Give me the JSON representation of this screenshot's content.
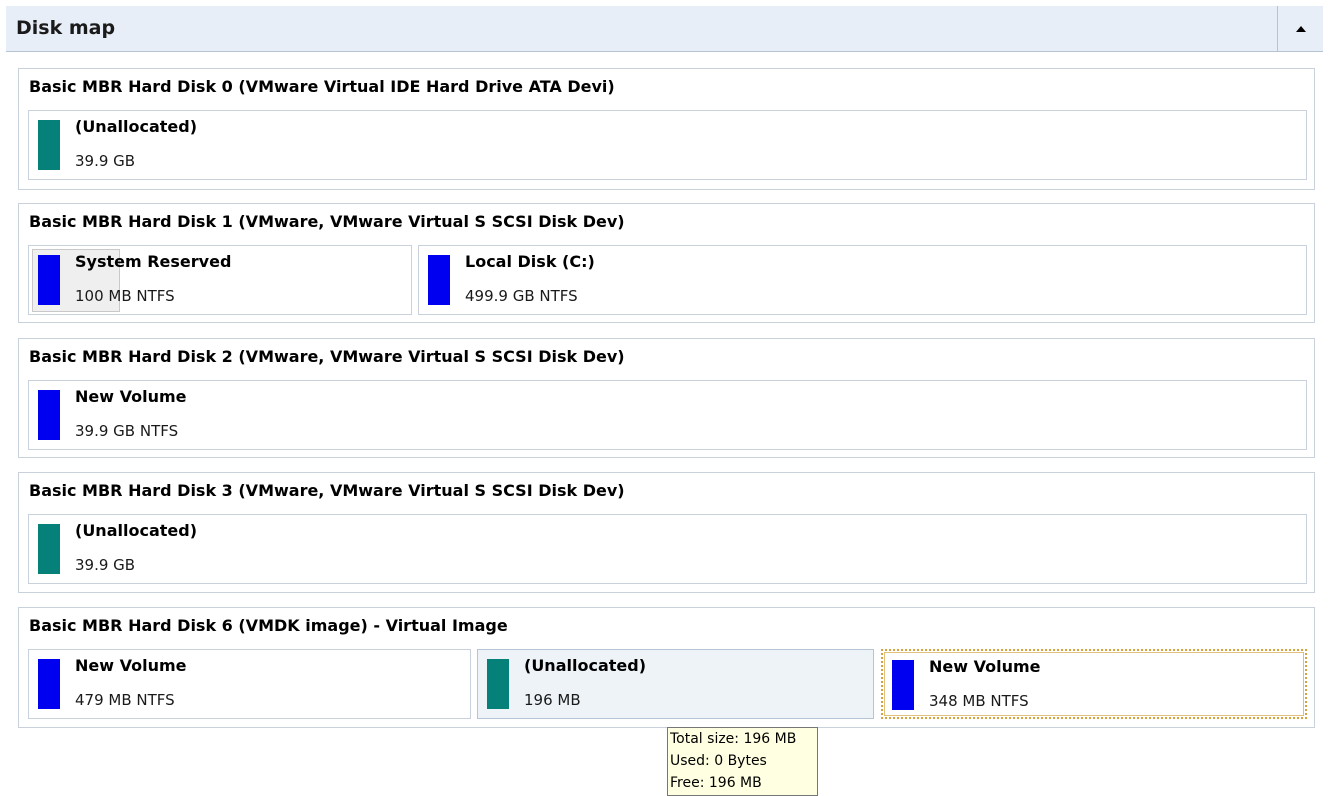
{
  "header": {
    "title": "Disk map"
  },
  "disks": [
    {
      "title": "Basic MBR Hard Disk 0 (VMware Virtual IDE Hard Drive ATA Devi)",
      "partitions": [
        {
          "name": "(Unallocated)",
          "size": "39.9 GB",
          "color": "#06817a"
        }
      ]
    },
    {
      "title": "Basic MBR Hard Disk 1 (VMware, VMware Virtual S SCSI Disk Dev)",
      "partitions": [
        {
          "name": "System Reserved",
          "size": "100 MB NTFS",
          "color": "#0000f0"
        },
        {
          "name": "Local Disk (C:)",
          "size": "499.9 GB NTFS",
          "color": "#0000f0"
        }
      ]
    },
    {
      "title": "Basic MBR Hard Disk 2 (VMware, VMware Virtual S SCSI Disk Dev)",
      "partitions": [
        {
          "name": "New Volume",
          "size": "39.9 GB NTFS",
          "color": "#0000f0"
        }
      ]
    },
    {
      "title": "Basic MBR Hard Disk 3 (VMware, VMware Virtual S SCSI Disk Dev)",
      "partitions": [
        {
          "name": "(Unallocated)",
          "size": "39.9 GB",
          "color": "#06817a"
        }
      ]
    },
    {
      "title": "Basic MBR Hard Disk 6 (VMDK image) - Virtual Image",
      "partitions": [
        {
          "name": "New Volume",
          "size": "479 MB NTFS",
          "color": "#0000f0"
        },
        {
          "name": "(Unallocated)",
          "size": "196 MB",
          "color": "#06817a"
        },
        {
          "name": "New Volume",
          "size": "348 MB NTFS",
          "color": "#0000f0"
        }
      ]
    }
  ],
  "tooltip": {
    "total": "Total size: 196 MB",
    "used": "Used: 0 Bytes",
    "free": "Free: 196 MB"
  }
}
